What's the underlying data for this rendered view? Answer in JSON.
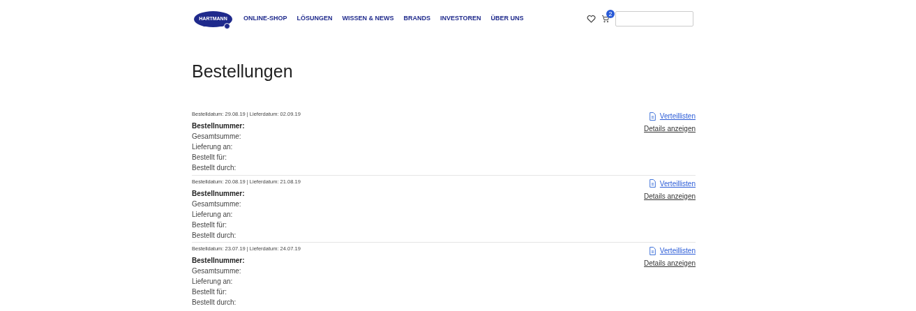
{
  "header": {
    "logo": "HARTMANN",
    "nav": [
      "ONLINE-SHOP",
      "LÖSUNGEN",
      "WISSEN & NEWS",
      "BRANDS",
      "INVESTOREN",
      "ÜBER UNS"
    ],
    "cart_count": "2"
  },
  "page_title": "Bestellungen",
  "orders": [
    {
      "date_line": "Bestelldatum: 29.08.19 | Lieferdatum: 02.09.19",
      "fields": [
        {
          "label": "Bestellnummer:",
          "bold": true
        },
        {
          "label": "Gesamtsumme:",
          "bold": false
        },
        {
          "label": "Lieferung an:",
          "bold": false
        },
        {
          "label": "Bestellt für:",
          "bold": false
        },
        {
          "label": "Bestellt durch:",
          "bold": false
        }
      ],
      "list_link": "Verteillisten",
      "details_link": "Details anzeigen"
    },
    {
      "date_line": "Bestelldatum: 20.08.19 | Lieferdatum: 21.08.19",
      "fields": [
        {
          "label": "Bestellnummer:",
          "bold": true
        },
        {
          "label": "Gesamtsumme:",
          "bold": false
        },
        {
          "label": "Lieferung an:",
          "bold": false
        },
        {
          "label": "Bestellt für:",
          "bold": false
        },
        {
          "label": "Bestellt durch:",
          "bold": false
        }
      ],
      "list_link": "Verteillisten",
      "details_link": "Details anzeigen"
    },
    {
      "date_line": "Bestelldatum: 23.07.19 | Lieferdatum: 24.07.19",
      "fields": [
        {
          "label": "Bestellnummer:",
          "bold": true
        },
        {
          "label": "Gesamtsumme:",
          "bold": false
        },
        {
          "label": "Lieferung an:",
          "bold": false
        },
        {
          "label": "Bestellt für:",
          "bold": false
        },
        {
          "label": "Bestellt durch:",
          "bold": false
        }
      ],
      "list_link": "Verteillisten",
      "details_link": "Details anzeigen"
    }
  ]
}
